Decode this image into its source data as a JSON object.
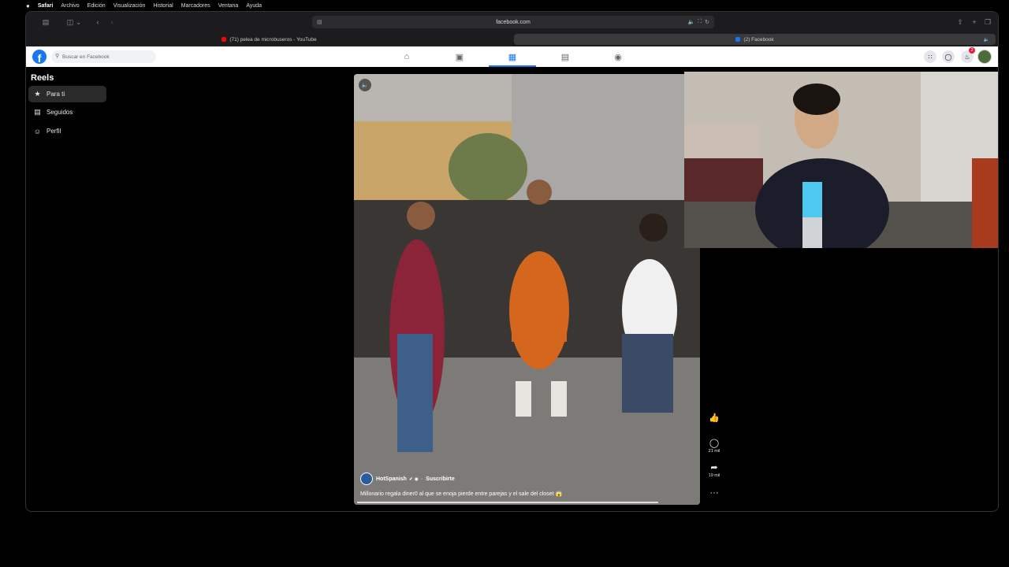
{
  "menubar": {
    "apple": "",
    "items": [
      "Safari",
      "Archivo",
      "Edición",
      "Visualización",
      "Historial",
      "Marcadores",
      "Ventana",
      "Ayuda"
    ]
  },
  "browser": {
    "url": "facebook.com",
    "tabs": [
      {
        "label": "(71) pelea de microbuseros - YouTube",
        "favicon_color": "#ff0000",
        "active": false
      },
      {
        "label": "(2) Facebook",
        "favicon_color": "#1877f2",
        "active": true
      }
    ]
  },
  "facebook": {
    "logo": "f",
    "search_placeholder": "Buscar en Facebook",
    "nav_icons": [
      "home-icon",
      "video-icon",
      "reels-icon",
      "marketplace-icon",
      "gaming-icon"
    ],
    "active_nav": "reels-icon",
    "notification_count": "2"
  },
  "sidebar": {
    "title": "Reels",
    "items": [
      {
        "label": "Para ti",
        "icon": "star-icon",
        "active": true
      },
      {
        "label": "Seguidos",
        "icon": "following-icon",
        "active": false
      },
      {
        "label": "Perfil",
        "icon": "profile-icon",
        "active": false
      }
    ]
  },
  "reel": {
    "author": "HotSpanish",
    "subscribe_label": "Suscribirte",
    "separator": "·",
    "caption": "Millonario regala diner0 al que se enoja pierde entre parejas y el sale del closet 😱",
    "progress": 0.87,
    "actions": {
      "like_count": "",
      "comment_count": "21 mil",
      "share_count": "19 mil"
    }
  },
  "colors": {
    "fb_blue": "#1877f2",
    "background": "#000000"
  }
}
